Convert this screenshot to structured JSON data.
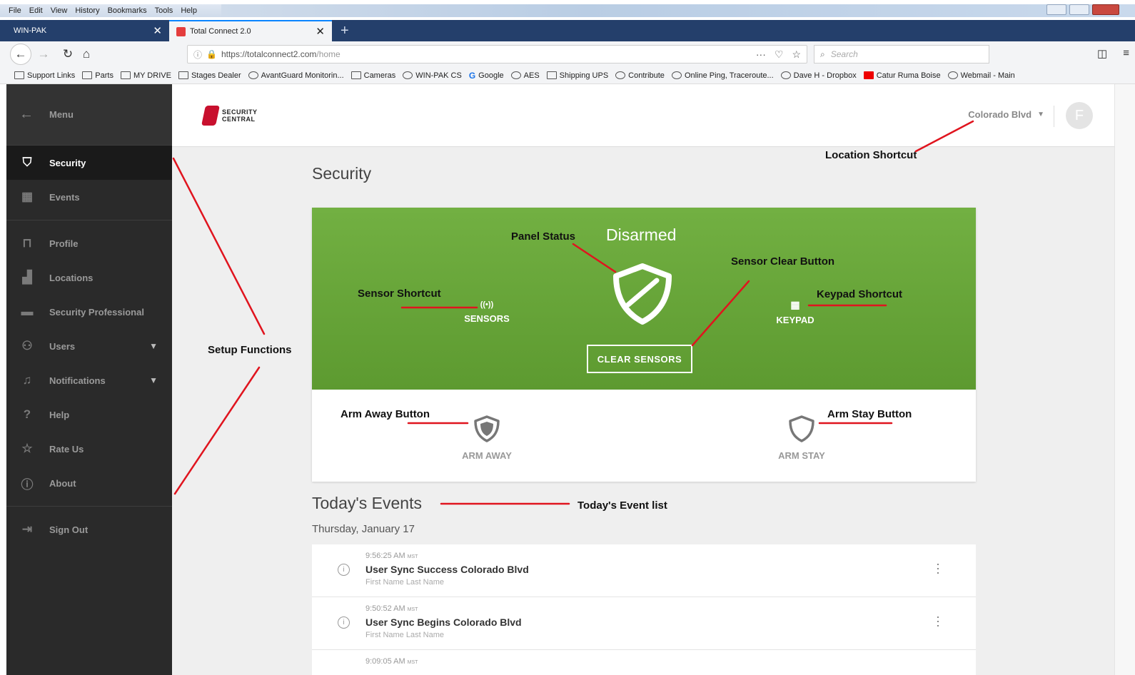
{
  "browser": {
    "menu": [
      "File",
      "Edit",
      "View",
      "History",
      "Bookmarks",
      "Tools",
      "Help"
    ],
    "tabs": [
      {
        "label": "WIN-PAK"
      },
      {
        "label": "Total Connect 2.0"
      }
    ],
    "url_host": "https://totalconnect2.com",
    "url_path": "/home",
    "search_placeholder": "Search",
    "bookmarks": [
      "Support Links",
      "Parts",
      "MY DRIVE",
      "Stages Dealer",
      "AvantGuard Monitorin...",
      "Cameras",
      "WIN-PAK CS",
      "Google",
      "AES",
      "Shipping UPS",
      "Contribute",
      "Online Ping, Traceroute...",
      "Dave H - Dropbox",
      "Catur Ruma Boise",
      "Webmail - Main"
    ]
  },
  "sidebar": {
    "menu_label": "Menu",
    "items": [
      {
        "label": "Security",
        "icon": "shield-icon"
      },
      {
        "label": "Events",
        "icon": "calendar-icon"
      },
      {
        "label": "Profile",
        "icon": "lock-icon"
      },
      {
        "label": "Locations",
        "icon": "building-icon"
      },
      {
        "label": "Security Professional",
        "icon": "truck-icon"
      },
      {
        "label": "Users",
        "icon": "users-icon"
      },
      {
        "label": "Notifications",
        "icon": "bell-icon"
      },
      {
        "label": "Help",
        "icon": "question-icon"
      },
      {
        "label": "Rate Us",
        "icon": "star-icon"
      },
      {
        "label": "About",
        "icon": "info-icon"
      },
      {
        "label": "Sign Out",
        "icon": "sign-out-icon"
      }
    ]
  },
  "header": {
    "logo_line1": "SECURITY",
    "logo_line2": "CENTRAL",
    "location": "Colorado Blvd",
    "avatar_initial": "F"
  },
  "security": {
    "title": "Security",
    "status": "Disarmed",
    "sensors_label": "SENSORS",
    "keypad_label": "KEYPAD",
    "clear_label": "CLEAR SENSORS",
    "arm_away_label": "ARM AWAY",
    "arm_stay_label": "ARM STAY"
  },
  "events": {
    "title": "Today's Events",
    "date": "Thursday, January 17",
    "items": [
      {
        "time": "9:56:25 AM",
        "tz": "MST",
        "title": "User Sync Success Colorado Blvd",
        "user": "First Name Last Name"
      },
      {
        "time": "9:50:52 AM",
        "tz": "MST",
        "title": "User Sync Begins Colorado Blvd",
        "user": "First Name Last Name"
      },
      {
        "time": "9:09:05 AM",
        "tz": "MST",
        "title": "",
        "user": ""
      }
    ]
  },
  "annotations": {
    "location_shortcut": "Location Shortcut",
    "panel_status": "Panel Status",
    "sensor_clear_button": "Sensor Clear Button",
    "sensor_shortcut": "Sensor Shortcut",
    "keypad_shortcut": "Keypad Shortcut",
    "setup_functions": "Setup Functions",
    "arm_away_button": "Arm Away Button",
    "arm_stay_button": "Arm Stay Button",
    "todays_event_list": "Today's Event list"
  },
  "colors": {
    "panel_green": "#68a83b",
    "annotation_red": "#e0141e",
    "sidebar_bg": "#2a2a2a",
    "brand_red": "#c8102e"
  }
}
